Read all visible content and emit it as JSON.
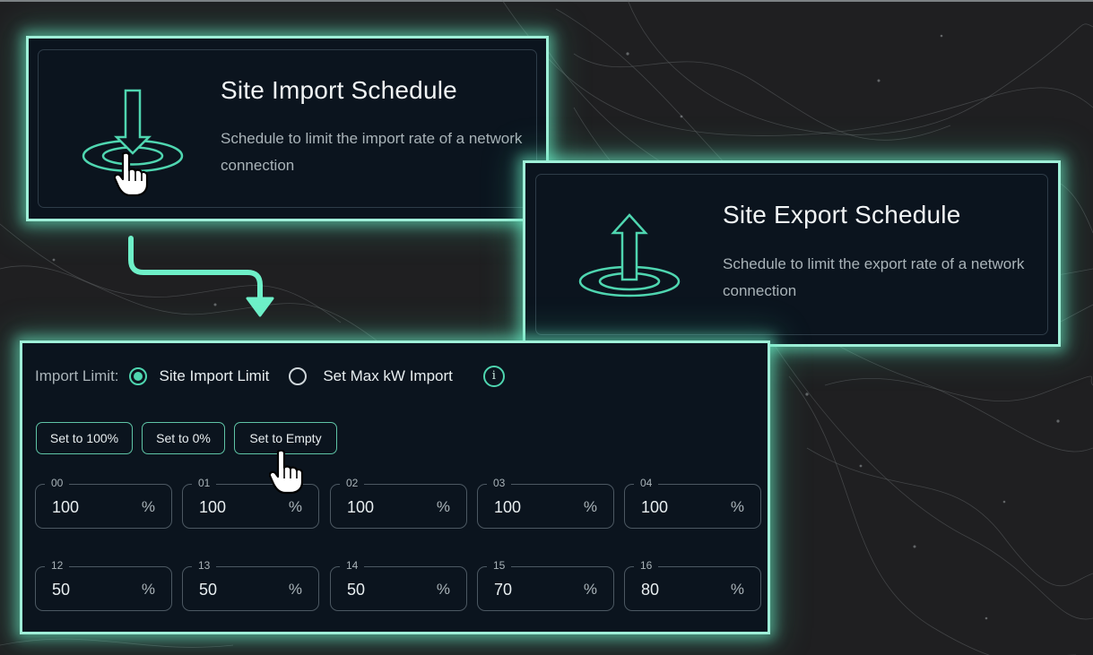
{
  "import_card": {
    "title": "Site Import Schedule",
    "description": "Schedule to limit the import rate of a network connection",
    "icon": "import-arrow-icon"
  },
  "export_card": {
    "title": "Site Export Schedule",
    "description": "Schedule to limit the export rate of a network connection",
    "icon": "export-arrow-icon"
  },
  "import_panel": {
    "import_limit_label": "Import Limit:",
    "radio_options": [
      {
        "label": "Site Import Limit",
        "selected": true
      },
      {
        "label": "Set Max kW Import",
        "selected": false
      }
    ],
    "info_icon": "i",
    "buttons": [
      "Set to 100%",
      "Set to 0%",
      "Set to Empty"
    ],
    "hour_fields_row1": [
      {
        "hour": "00",
        "value": "100",
        "unit": "%"
      },
      {
        "hour": "01",
        "value": "100",
        "unit": "%"
      },
      {
        "hour": "02",
        "value": "100",
        "unit": "%"
      },
      {
        "hour": "03",
        "value": "100",
        "unit": "%"
      },
      {
        "hour": "04",
        "value": "100",
        "unit": "%"
      }
    ],
    "hour_fields_row2": [
      {
        "hour": "12",
        "value": "50",
        "unit": "%"
      },
      {
        "hour": "13",
        "value": "50",
        "unit": "%"
      },
      {
        "hour": "14",
        "value": "50",
        "unit": "%"
      },
      {
        "hour": "15",
        "value": "70",
        "unit": "%"
      },
      {
        "hour": "16",
        "value": "80",
        "unit": "%"
      }
    ]
  },
  "colors": {
    "accent": "#4fd6b0",
    "glow": "#9ff0d8",
    "panel_bg": "#0b141e",
    "page_bg": "#1f1f21"
  }
}
